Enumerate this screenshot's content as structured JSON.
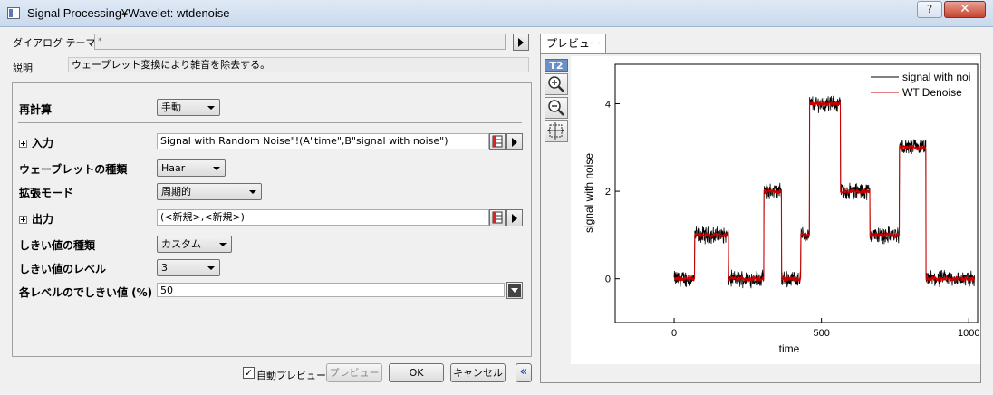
{
  "window": {
    "title": "Signal Processing¥Wavelet: wtdenoise",
    "help_label": "?",
    "close_label": "✕"
  },
  "theme": {
    "label": "ダイアログ テーマ(H)",
    "value": "*"
  },
  "description": {
    "label": "説明",
    "value": "ウェーブレット変換により雑音を除去する。"
  },
  "form": {
    "recalc": {
      "label": "再計算",
      "value": "手動"
    },
    "input": {
      "label": "入力",
      "value": "Signal with Random Noise\"!(A\"time\",B\"signal with noise\")"
    },
    "wavelet_type": {
      "label": "ウェーブレットの種類",
      "value": "Haar"
    },
    "extension_mode": {
      "label": "拡張モード",
      "value": "周期的"
    },
    "output": {
      "label": "出力",
      "value": "(<新規>,<新規>)"
    },
    "threshold_type": {
      "label": "しきい値の種類",
      "value": "カスタム"
    },
    "threshold_level": {
      "label": "しきい値のレベル",
      "value": "3"
    },
    "threshold_percent": {
      "label": "各レベルのでしきい値 (%)",
      "value": "50"
    }
  },
  "footer": {
    "auto_preview_label": "自動プレビュー",
    "auto_preview_checked": true,
    "preview_button": "プレビュー",
    "ok_button": "OK",
    "cancel_button": "キャンセル",
    "collapse_button": "«"
  },
  "preview": {
    "tab_label": "プレビュー",
    "layer_label": "T2"
  },
  "chart_data": {
    "type": "line",
    "xlabel": "time",
    "ylabel": "signal with noise",
    "xlim": [
      -200,
      1030
    ],
    "ylim": [
      -1.0,
      4.9
    ],
    "xticks": [
      0,
      500,
      1000
    ],
    "yticks": [
      0,
      2,
      4
    ],
    "legend_position": "top-right",
    "series": [
      {
        "name": "signal with noi",
        "color": "#000000"
      },
      {
        "name": "WT Denoise",
        "color": "#cc0000"
      }
    ],
    "step_levels": [
      {
        "x0": 0,
        "x1": 70,
        "y": 0
      },
      {
        "x0": 70,
        "x1": 185,
        "y": 1
      },
      {
        "x0": 185,
        "x1": 305,
        "y": 0
      },
      {
        "x0": 305,
        "x1": 365,
        "y": 2
      },
      {
        "x0": 365,
        "x1": 430,
        "y": 0
      },
      {
        "x0": 430,
        "x1": 460,
        "y": 1
      },
      {
        "x0": 460,
        "x1": 565,
        "y": 4
      },
      {
        "x0": 565,
        "x1": 665,
        "y": 2
      },
      {
        "x0": 665,
        "x1": 765,
        "y": 1
      },
      {
        "x0": 765,
        "x1": 855,
        "y": 3
      },
      {
        "x0": 855,
        "x1": 1020,
        "y": 0
      }
    ]
  }
}
